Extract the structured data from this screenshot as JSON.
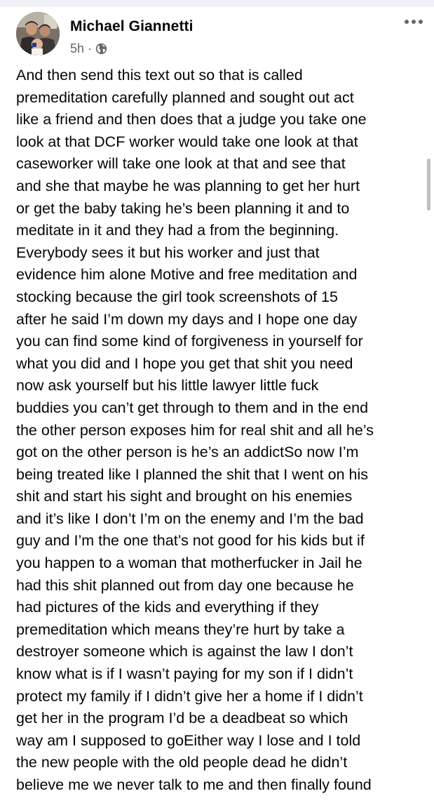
{
  "post": {
    "author": {
      "name": "Michael Giannetti",
      "avatar_icon": "profile-photo"
    },
    "meta": {
      "time": "5h",
      "separator": "·",
      "audience_icon": "globe-icon"
    },
    "more_icon": "more-options-icon",
    "text": "And then send this text out so that is called\npremeditation carefully planned and sought out act\nlike a friend and then does that a judge you take one\nlook at that DCF worker would take one look at that\ncaseworker will take one look at that and see that\nand she that maybe he was planning to get her hurt\nor get the baby taking he’s been planning it and to\nmeditate in it and they had a  from the beginning.\nEverybody sees it but his worker and just that\nevidence him alone Motive and free meditation and\nstocking because the girl took screenshots of 15\nafter he said I’m down my days and I hope one day\nyou can find some kind of forgiveness in yourself for\nwhat you did and I hope you get that shit you need\nnow ask yourself but his little lawyer little fuck\nbuddies you can’t get through to them and in the end\nthe other person exposes him for real shit and all he’s\ngot on the other person is he’s an addictSo now I’m\nbeing treated like I planned the shit that I went on his\nshit and start his sight and brought on his enemies\nand it’s like I don’t I’m on the enemy and I’m the bad\nguy and I’m the one that’s not good for his kids but if\nyou happen to a woman that motherfucker in Jail he\nhad this shit planned out from day one because he\nhad pictures of the kids and everything if they\npremeditation which means they’re hurt by take a\ndestroyer someone which is against the law I don’t\nknow what is if I wasn’t paying for my son if I didn’t\nprotect my family if I didn’t give her a home if I didn’t\nget her in the program I’d be a deadbeat so which\nway am I supposed to goEither way I lose and I told\nthe new people with the old people dead he didn’t\nbelieve me we never talk to me and then finally found"
  },
  "colors": {
    "text": "#050505",
    "secondary_text": "#65676b",
    "background": "#ffffff",
    "scrollbar": "#bcc0c4"
  }
}
